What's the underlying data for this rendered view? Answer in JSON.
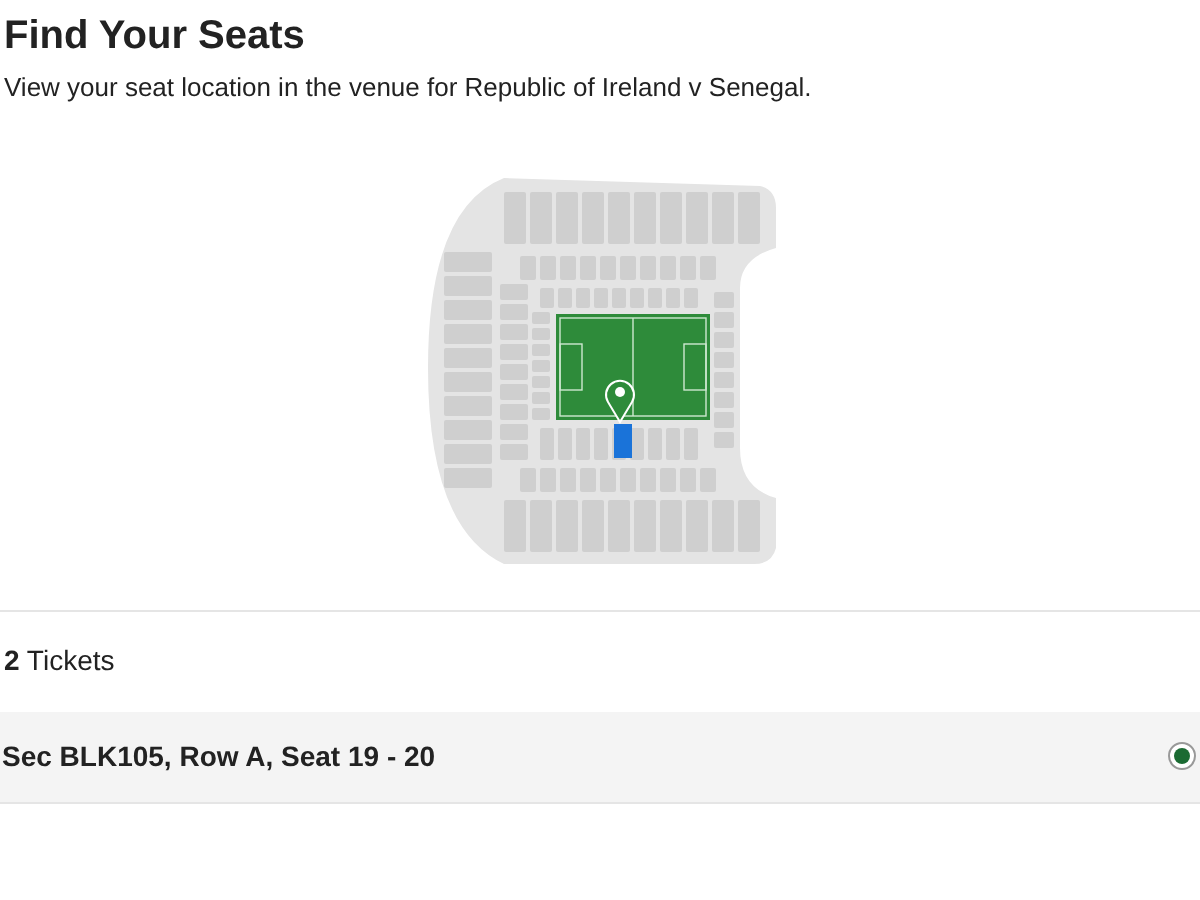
{
  "title": "Find Your Seats",
  "subtitle": "View your seat location in the venue for Republic of Ireland v Senegal.",
  "tickets_heading": "**2** Tickets",
  "tickets": [
    {
      "label": "Sec BLK105, Row A, Seat 19 - 20",
      "selected": true
    }
  ]
}
